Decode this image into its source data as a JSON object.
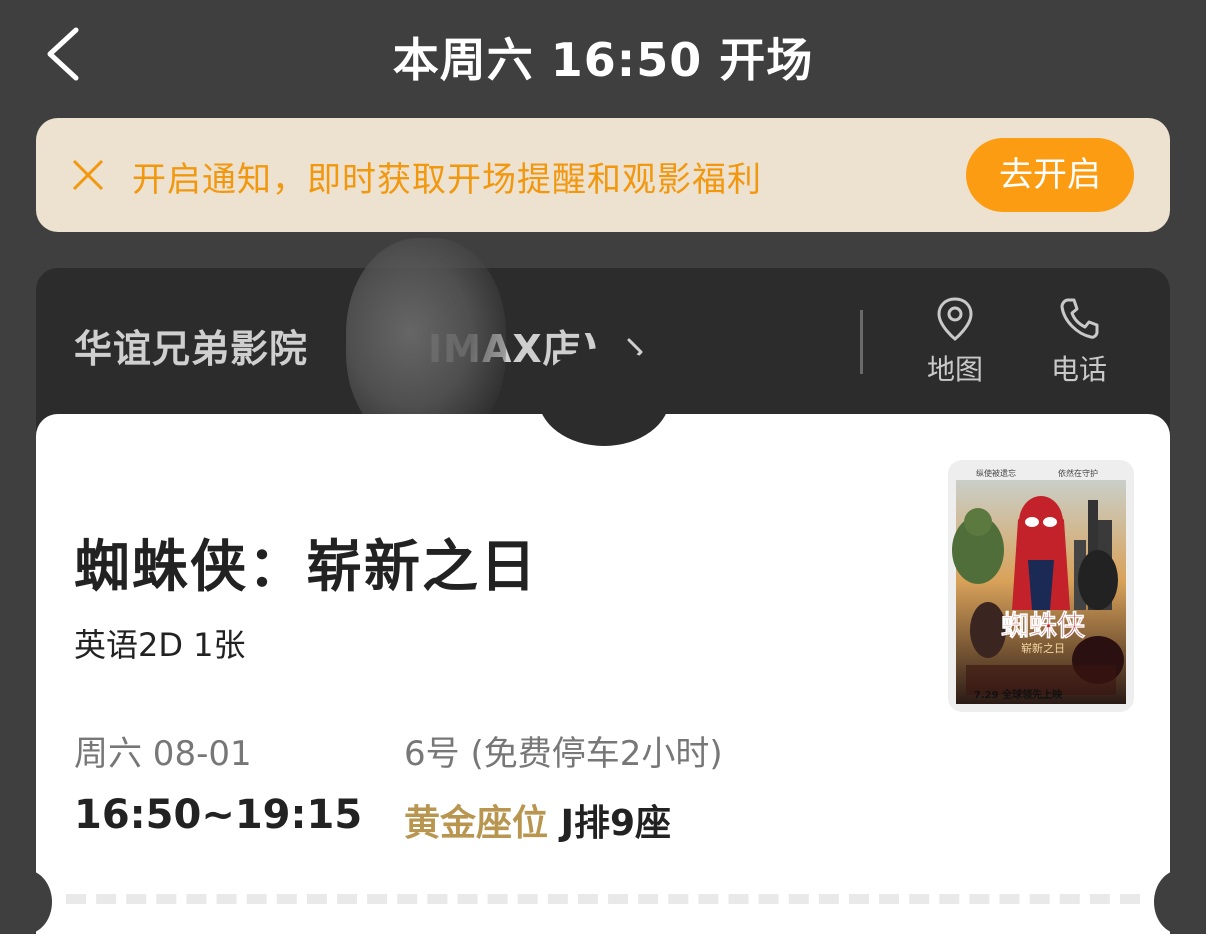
{
  "header": {
    "title": "本周六 16:50 开场"
  },
  "notice": {
    "text": "开启通知，即时获取开场提醒和观影福利",
    "button_label": "去开启"
  },
  "cinema": {
    "name": "华谊兄弟影院",
    "name_suffix": "IMAX店)",
    "map_label": "地图",
    "phone_label": "电话"
  },
  "movie": {
    "title": "蜘蛛侠：崭新之日",
    "subtitle": "英语2D 1张",
    "date": "周六 08-01",
    "time": "16:50~19:15",
    "hall": "6号 (免费停车2小时)",
    "seat_level": "黄金座位",
    "seat": "J排9座",
    "poster": {
      "tagline_left": "纵使被遗忘",
      "tagline_right": "依然在守护",
      "title": "蜘蛛侠",
      "subtitle": "崭新之日",
      "release": "7.29 全球领先上映"
    }
  },
  "colors": {
    "accent": "#fc9c13",
    "gold": "#b89650",
    "background": "#3f3f3f"
  }
}
